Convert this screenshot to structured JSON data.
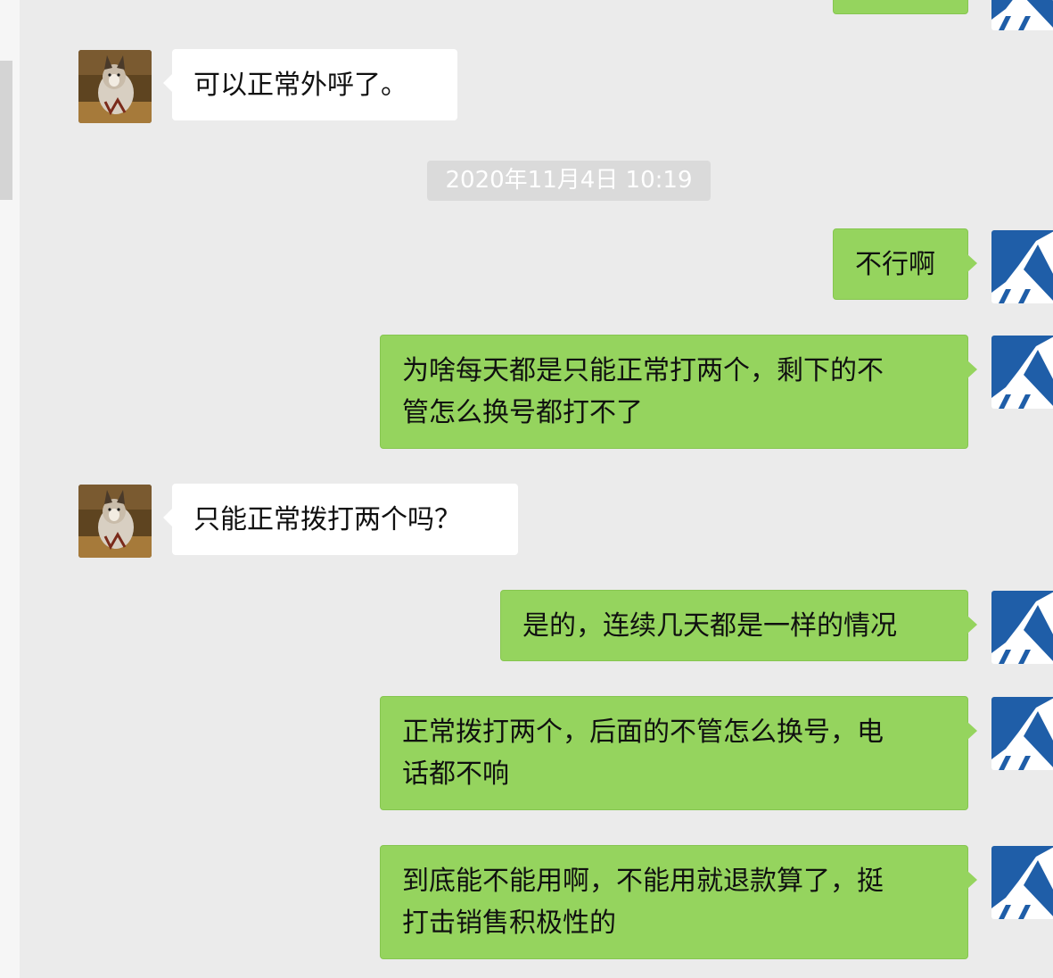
{
  "timestamp": "2020年11月4日 10:19",
  "messages": [
    {
      "side": "in",
      "lines": [
        "可以正常外呼了。"
      ]
    },
    {
      "side": "out",
      "lines": [
        "不行啊"
      ]
    },
    {
      "side": "out",
      "lines": [
        "为啥每天都是只能正常打两个，剩下的不",
        "管怎么换号都打不了"
      ]
    },
    {
      "side": "in",
      "lines": [
        "只能正常拨打两个吗？"
      ]
    },
    {
      "side": "out",
      "lines": [
        "是的，连续几天都是一样的情况"
      ]
    },
    {
      "side": "out",
      "lines": [
        "正常拨打两个，后面的不管怎么换号，电",
        "话都不响"
      ]
    },
    {
      "side": "out",
      "lines": [
        "到底能不能用啊，不能用就退款算了，挺",
        "打击销售积极性的"
      ]
    }
  ],
  "colors": {
    "background": "#ebebeb",
    "sent_bubble": "#95d45e",
    "received_bubble": "#ffffff",
    "timestamp_chip": "#dadada"
  },
  "icons": {
    "contact_avatar": "husky-dog-photo",
    "own_avatar": "blue-mountain-logo"
  }
}
